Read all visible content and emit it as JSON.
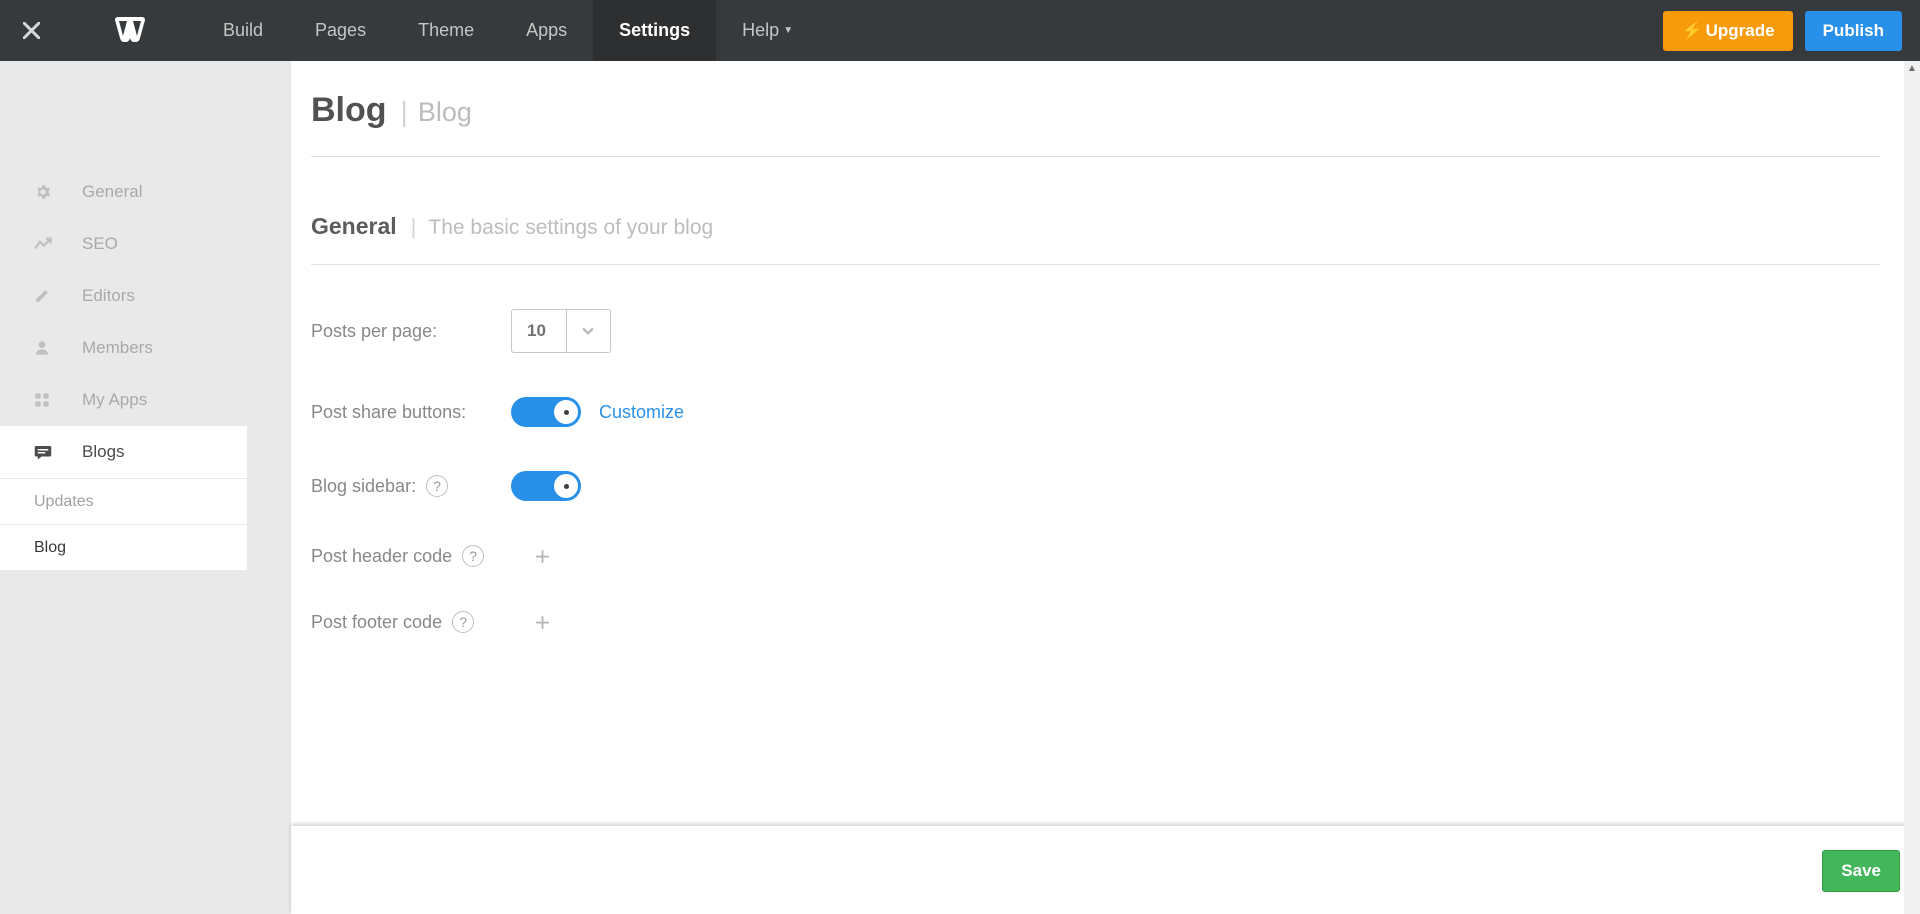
{
  "topnav": {
    "items": [
      {
        "label": "Build"
      },
      {
        "label": "Pages"
      },
      {
        "label": "Theme"
      },
      {
        "label": "Apps"
      },
      {
        "label": "Settings",
        "active": true
      },
      {
        "label": "Help",
        "caret": true
      }
    ],
    "upgrade_label": "Upgrade",
    "publish_label": "Publish"
  },
  "sidebar": {
    "items": [
      {
        "label": "General"
      },
      {
        "label": "SEO"
      },
      {
        "label": "Editors"
      },
      {
        "label": "Members"
      },
      {
        "label": "My Apps"
      },
      {
        "label": "Blogs",
        "active": true
      }
    ],
    "sub_items": [
      {
        "label": "Updates"
      },
      {
        "label": "Blog",
        "active": true
      }
    ]
  },
  "page": {
    "title": "Blog",
    "breadcrumb": "Blog",
    "section": {
      "title": "General",
      "desc": "The basic settings of your blog"
    },
    "settings": {
      "posts_per_page": {
        "label": "Posts per page:",
        "value": "10"
      },
      "share_buttons": {
        "label": "Post share buttons:",
        "link": "Customize"
      },
      "sidebar": {
        "label": "Blog sidebar:"
      },
      "header_code": {
        "label": "Post header code"
      },
      "footer_code": {
        "label": "Post footer code"
      }
    },
    "save_label": "Save"
  }
}
